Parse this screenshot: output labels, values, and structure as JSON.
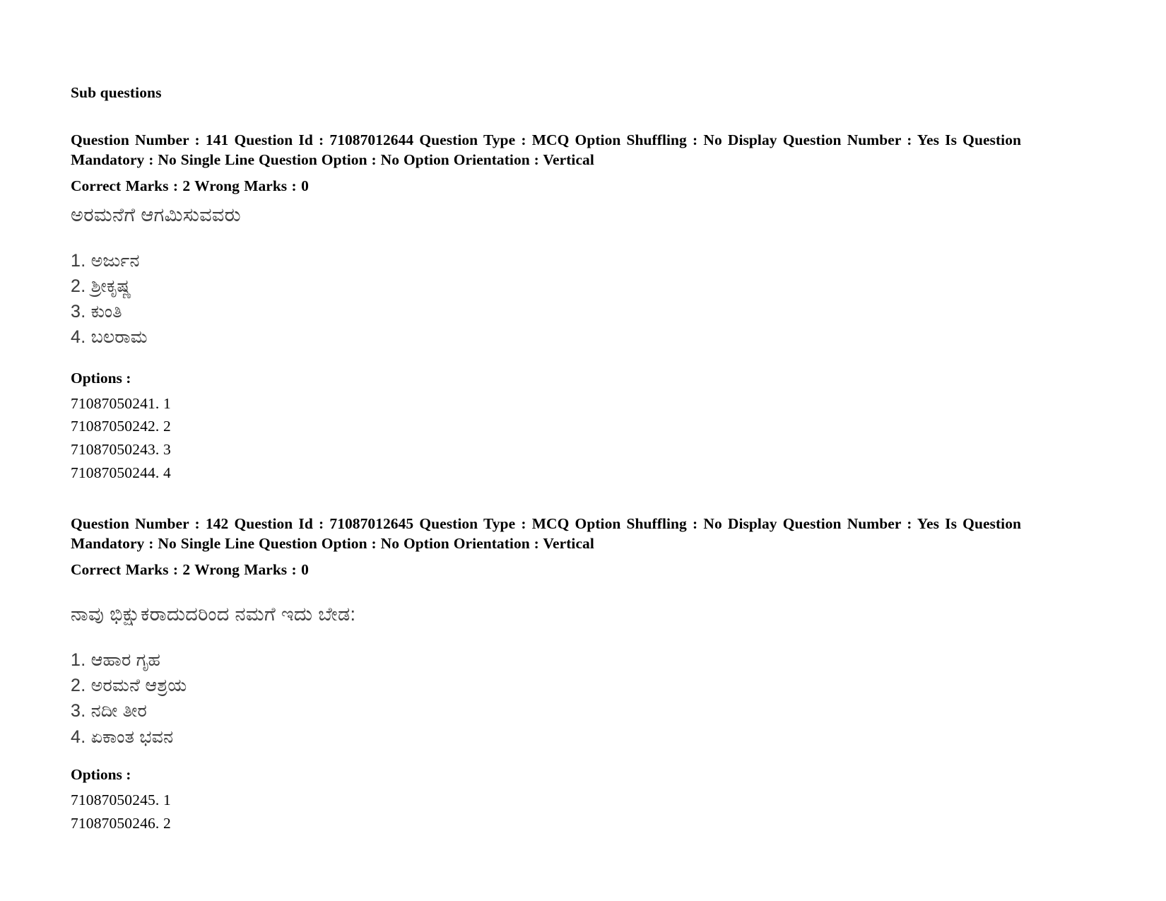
{
  "document": {
    "section_heading": "Sub questions",
    "options_label": "Options :"
  },
  "questions": [
    {
      "meta_line": "Question Number : 141 Question Id : 71087012644 Question Type : MCQ Option Shuffling : No Display Question Number : Yes Is Question Mandatory : No Single Line Question Option : No Option Orientation : Vertical",
      "marks_line": "Correct Marks : 2 Wrong Marks : 0",
      "question_number": "141",
      "question_id": "71087012644",
      "question_type": "MCQ",
      "option_shuffling": "No",
      "display_question_number": "Yes",
      "is_question_mandatory": "No",
      "single_line_question_option": "No",
      "option_orientation": "Vertical",
      "correct_marks": "2",
      "wrong_marks": "0",
      "stem_text": "ಅರಮನೆಗೆ ಆಗಮಿಸುವವರು",
      "choices": [
        "1. ಅರ್ಜುನ",
        "2. ಶ್ರೀಕೃಷ್ಣ",
        "3. ಕುಂತಿ",
        "4. ಬಲರಾಮ"
      ],
      "option_ids": [
        "71087050241. 1",
        "71087050242. 2",
        "71087050243. 3",
        "71087050244. 4"
      ]
    },
    {
      "meta_line": "Question Number : 142 Question Id : 71087012645 Question Type : MCQ Option Shuffling : No Display Question Number : Yes Is Question Mandatory : No Single Line Question Option : No Option Orientation : Vertical",
      "marks_line": "Correct Marks : 2 Wrong Marks : 0",
      "question_number": "142",
      "question_id": "71087012645",
      "question_type": "MCQ",
      "option_shuffling": "No",
      "display_question_number": "Yes",
      "is_question_mandatory": "No",
      "single_line_question_option": "No",
      "option_orientation": "Vertical",
      "correct_marks": "2",
      "wrong_marks": "0",
      "stem_text": "ನಾವು ಭಿಕ್ಷುಕರಾದುದರಿಂದ ನಮಗೆ ಇದು ಬೇಡ:",
      "choices": [
        "1. ಆಹಾರ ಗೃಹ",
        "2. ಅರಮನೆ ಆಶ್ರಯ",
        "3. ನದೀ ತೀರ",
        "4. ಏಕಾಂತ ಭವನ"
      ],
      "option_ids": [
        "71087050245. 1",
        "71087050246. 2"
      ]
    }
  ]
}
